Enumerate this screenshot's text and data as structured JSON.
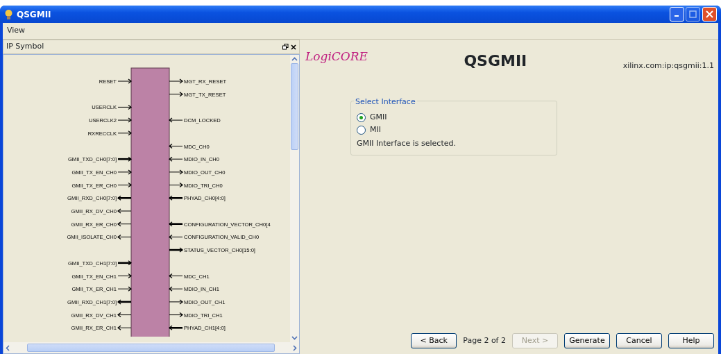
{
  "window": {
    "title": "QSGMII"
  },
  "menu": [
    {
      "label": "View"
    }
  ],
  "ip_symbol_panel": {
    "title": "IP Symbol",
    "left_pins": [
      [
        {
          "name": "RESET",
          "output": false,
          "bus": false
        }
      ],
      [
        {
          "name": "USERCLK",
          "output": false,
          "bus": false
        },
        {
          "name": "USERCLK2",
          "output": false,
          "bus": false
        },
        {
          "name": "RXRECCLK",
          "output": false,
          "bus": false
        }
      ],
      [
        {
          "name": "GMII_TXD_CH0[7:0]",
          "output": false,
          "bus": true
        },
        {
          "name": "GMII_TX_EN_CH0",
          "output": false,
          "bus": false
        },
        {
          "name": "GMII_TX_ER_CH0",
          "output": false,
          "bus": false
        },
        {
          "name": "GMII_RXD_CH0[7:0]",
          "output": true,
          "bus": true
        },
        {
          "name": "GMII_RX_DV_CH0",
          "output": true,
          "bus": false
        },
        {
          "name": "GMII_RX_ER_CH0",
          "output": true,
          "bus": false
        },
        {
          "name": "GMII_ISOLATE_CH0",
          "output": true,
          "bus": false
        }
      ],
      [
        {
          "name": "GMII_TXD_CH1[7:0]",
          "output": false,
          "bus": true
        },
        {
          "name": "GMII_TX_EN_CH1",
          "output": false,
          "bus": false
        },
        {
          "name": "GMII_TX_ER_CH1",
          "output": false,
          "bus": false
        },
        {
          "name": "GMII_RXD_CH1[7:0]",
          "output": true,
          "bus": true
        },
        {
          "name": "GMII_RX_DV_CH1",
          "output": true,
          "bus": false
        },
        {
          "name": "GMII_RX_ER_CH1",
          "output": true,
          "bus": false
        }
      ]
    ],
    "right_pins": [
      [
        {
          "name": "MGT_RX_RESET",
          "output": true,
          "bus": false
        },
        {
          "name": "MGT_TX_RESET",
          "output": true,
          "bus": false
        }
      ],
      [
        {
          "name": "DCM_LOCKED",
          "output": false,
          "bus": false
        }
      ],
      [
        {
          "name": "MDC_CH0",
          "output": false,
          "bus": false
        },
        {
          "name": "MDIO_IN_CH0",
          "output": false,
          "bus": false
        },
        {
          "name": "MDIO_OUT_CH0",
          "output": true,
          "bus": false
        },
        {
          "name": "MDIO_TRI_CH0",
          "output": true,
          "bus": false
        },
        {
          "name": "PHYAD_CH0[4:0]",
          "output": false,
          "bus": true
        }
      ],
      [
        {
          "name": "CONFIGURATION_VECTOR_CH0[4",
          "output": false,
          "bus": true
        },
        {
          "name": "CONFIGURATION_VALID_CH0",
          "output": false,
          "bus": false
        },
        {
          "name": "STATUS_VECTOR_CH0[15:0]",
          "output": true,
          "bus": true
        }
      ],
      [
        {
          "name": "MDC_CH1",
          "output": false,
          "bus": false
        },
        {
          "name": "MDIO_IN_CH1",
          "output": false,
          "bus": false
        },
        {
          "name": "MDIO_OUT_CH1",
          "output": true,
          "bus": false
        },
        {
          "name": "MDIO_TRI_CH1",
          "output": true,
          "bus": false
        },
        {
          "name": "PHYAD_CH1[4:0]",
          "output": false,
          "bus": true
        }
      ]
    ]
  },
  "wizard": {
    "logo": "LogiCORE",
    "title": "QSGMII",
    "version": "xilinx.com:ip:qsgmii:1.1",
    "group": {
      "title": "Select Interface",
      "options": [
        {
          "label": "GMII",
          "selected": true
        },
        {
          "label": "MII",
          "selected": false
        }
      ],
      "status": "GMII Interface is selected."
    },
    "page_label": "Page 2 of 2",
    "buttons": [
      {
        "label": "< Back",
        "disabled": false
      },
      {
        "label": "Next >",
        "disabled": true
      },
      {
        "label": "Generate",
        "disabled": false
      },
      {
        "label": "Cancel",
        "disabled": false
      },
      {
        "label": "Help",
        "disabled": false
      }
    ]
  }
}
